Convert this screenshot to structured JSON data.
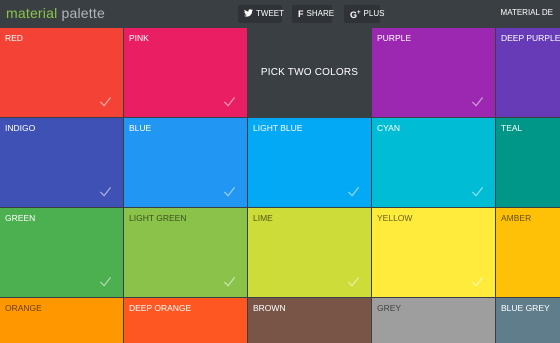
{
  "header": {
    "brand_main": "material",
    "brand_sub": "palette",
    "tweet": "TWEET",
    "share": "SHARE",
    "plus": "PLUS",
    "right_link": "MATERIAL DE"
  },
  "icons": {
    "tweet": "twitter-icon",
    "share": "facebook-icon",
    "plus": "google-plus-icon",
    "check": "checkmark-icon"
  },
  "picker_prompt": "PICK TWO COLORS",
  "colors": [
    {
      "name": "RED",
      "hex": "#f44336"
    },
    {
      "name": "PINK",
      "hex": "#e91e63"
    },
    {
      "name": "PURPLE",
      "hex": "#9c27b0"
    },
    {
      "name": "DEEP PURPLE",
      "hex": "#673ab7"
    },
    {
      "name": "INDIGO",
      "hex": "#3f51b5"
    },
    {
      "name": "BLUE",
      "hex": "#2196f3"
    },
    {
      "name": "LIGHT BLUE",
      "hex": "#03a9f4"
    },
    {
      "name": "CYAN",
      "hex": "#00bcd4"
    },
    {
      "name": "TEAL",
      "hex": "#009688"
    },
    {
      "name": "GREEN",
      "hex": "#4caf50"
    },
    {
      "name": "LIGHT GREEN",
      "hex": "#8bc34a"
    },
    {
      "name": "LIME",
      "hex": "#cddc39"
    },
    {
      "name": "YELLOW",
      "hex": "#ffeb3b"
    },
    {
      "name": "AMBER",
      "hex": "#ffc107"
    },
    {
      "name": "ORANGE",
      "hex": "#ff9800"
    },
    {
      "name": "DEEP ORANGE",
      "hex": "#ff5722"
    },
    {
      "name": "BROWN",
      "hex": "#795548"
    },
    {
      "name": "GREY",
      "hex": "#9e9e9e"
    },
    {
      "name": "BLUE GREY",
      "hex": "#607d8b"
    }
  ]
}
